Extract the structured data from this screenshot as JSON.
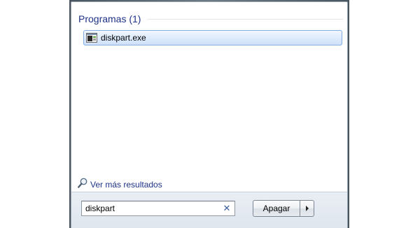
{
  "results": {
    "section_title": "Programas (1)",
    "items": [
      {
        "label": "diskpart.exe",
        "icon": "console-app-icon"
      }
    ]
  },
  "more_results": {
    "label": "Ver más resultados",
    "icon": "magnifier-icon"
  },
  "search": {
    "value": "diskpart",
    "clear_icon": "clear-x-icon"
  },
  "power": {
    "button_label": "Apagar",
    "arrow_icon": "right-arrow-icon"
  },
  "colors": {
    "header_text": "#1e3287",
    "selection_border": "#84acdd",
    "selection_fill": "#dceafc",
    "frame": "#5d6874"
  }
}
